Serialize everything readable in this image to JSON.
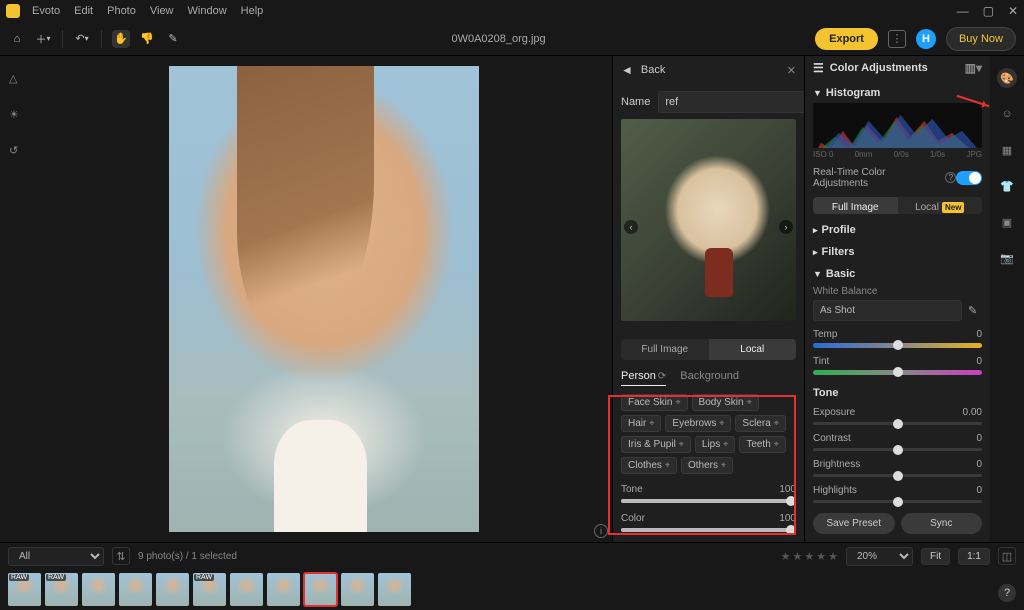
{
  "menu": {
    "items": [
      "Evoto",
      "Edit",
      "Photo",
      "View",
      "Window",
      "Help"
    ]
  },
  "toolbar": {
    "filename": "0W0A0208_org.jpg",
    "export": "Export",
    "buy": "Buy Now",
    "avatar": "H"
  },
  "mid": {
    "back": "Back",
    "name_label": "Name",
    "name_value": "ref",
    "seg": {
      "full": "Full Image",
      "local": "Local"
    },
    "tabs": {
      "person": "Person",
      "background": "Background"
    },
    "chips": [
      "Face Skin",
      "Body Skin",
      "Hair",
      "Eyebrows",
      "Sclera",
      "Iris & Pupil",
      "Lips",
      "Teeth",
      "Clothes",
      "Others"
    ],
    "tone": {
      "label": "Tone",
      "value": 100
    },
    "color": {
      "label": "Color",
      "value": 100
    }
  },
  "right": {
    "title": "Color Adjustments",
    "histogram": "Histogram",
    "hx": [
      "ISO 0",
      "0mm",
      "0/0s",
      "1/0s",
      "JPG"
    ],
    "rt": "Real-Time Color Adjustments",
    "seg": {
      "full": "Full Image",
      "local": "Local",
      "new": "New"
    },
    "profile": "Profile",
    "filters": "Filters",
    "basic": "Basic",
    "wb_label": "White Balance",
    "wb_value": "As Shot",
    "temp": {
      "label": "Temp",
      "value": "0"
    },
    "tint": {
      "label": "Tint",
      "value": "0"
    },
    "tone_h": "Tone",
    "exposure": {
      "label": "Exposure",
      "value": "0.00"
    },
    "contrast": {
      "label": "Contrast",
      "value": "0"
    },
    "brightness": {
      "label": "Brightness",
      "value": "0"
    },
    "highlights": {
      "label": "Highlights",
      "value": "0"
    },
    "save_preset": "Save Preset",
    "sync": "Sync"
  },
  "bottom": {
    "filter": "All",
    "count": "9 photo(s) / 1 selected",
    "zoom": "20%",
    "fit": "Fit",
    "one": "1:1",
    "thumbs": [
      {
        "tag": "RAW"
      },
      {
        "tag": "RAW"
      },
      {
        "tag": ""
      },
      {
        "tag": ""
      },
      {
        "tag": ""
      },
      {
        "tag": "RAW"
      },
      {
        "tag": ""
      },
      {
        "tag": ""
      },
      {
        "tag": "",
        "sel": true
      },
      {
        "tag": ""
      },
      {
        "tag": ""
      }
    ]
  }
}
